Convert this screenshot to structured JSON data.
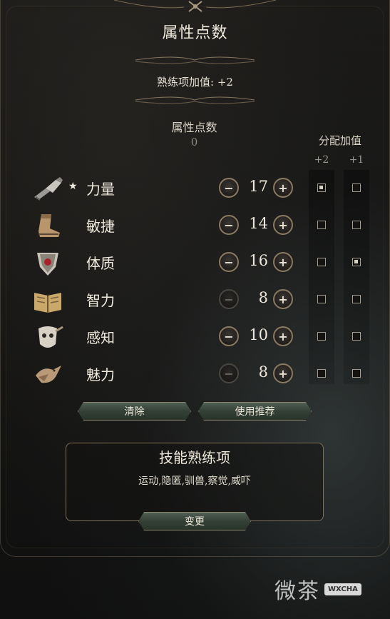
{
  "panel": {
    "title": "属性点数",
    "proficiency_bonus": "熟练项加值: +2",
    "points_label": "属性点数",
    "points_value": "0",
    "bonus_label": "分配加值",
    "bonus_col_plus2": "+2",
    "bonus_col_plus1": "+1"
  },
  "abilities": [
    {
      "name": "力量",
      "value": "17",
      "star": "★",
      "icon": "gauntlet-icon",
      "minus_enabled": true,
      "plus_enabled": true,
      "bonus2": true,
      "bonus1": false
    },
    {
      "name": "敏捷",
      "value": "14",
      "star": "",
      "icon": "boot-icon",
      "minus_enabled": true,
      "plus_enabled": true,
      "bonus2": false,
      "bonus1": false
    },
    {
      "name": "体质",
      "value": "16",
      "star": "",
      "icon": "shield-heart-icon",
      "minus_enabled": true,
      "plus_enabled": true,
      "bonus2": false,
      "bonus1": true
    },
    {
      "name": "智力",
      "value": "8",
      "star": "",
      "icon": "book-icon",
      "minus_enabled": false,
      "plus_enabled": true,
      "bonus2": false,
      "bonus1": false
    },
    {
      "name": "感知",
      "value": "10",
      "star": "",
      "icon": "mask-icon",
      "minus_enabled": true,
      "plus_enabled": true,
      "bonus2": false,
      "bonus1": false
    },
    {
      "name": "魅力",
      "value": "8",
      "star": "",
      "icon": "bird-icon",
      "minus_enabled": false,
      "plus_enabled": true,
      "bonus2": false,
      "bonus1": false
    }
  ],
  "buttons": {
    "clear": "清除",
    "recommend": "使用推荐",
    "change": "变更"
  },
  "skills": {
    "title": "技能熟练项",
    "list": "运动,隐匿,驯兽,察觉,威吓"
  },
  "watermark": {
    "text": "微茶",
    "badge": "WXCHA"
  },
  "colors": {
    "accent_gold": "#8a7a62",
    "button_green": "#344036",
    "text": "#efe9dc"
  }
}
